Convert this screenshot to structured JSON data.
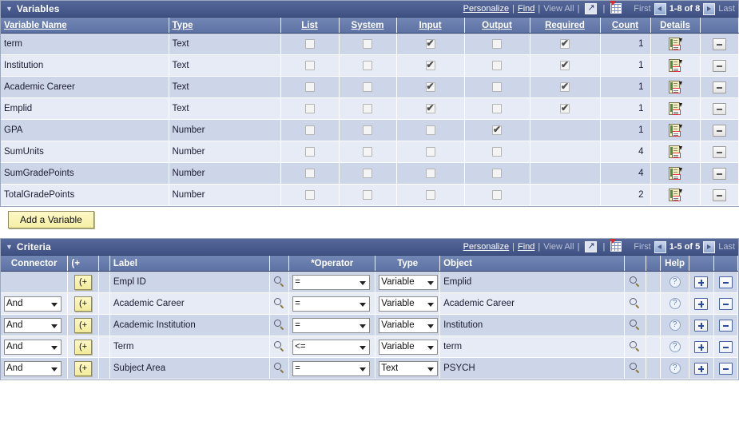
{
  "variables_section": {
    "title": "Variables",
    "toolbar": {
      "personalize": "Personalize",
      "find": "Find",
      "view_all": "View All",
      "expand_icon": "expand-icon",
      "grid_icon": "download-spreadsheet-icon",
      "first": "First",
      "range": "1-8 of 8",
      "last": "Last"
    },
    "columns": [
      "Variable Name",
      "Type",
      "List",
      "System",
      "Input",
      "Output",
      "Required",
      "Count",
      "Details",
      ""
    ],
    "rows": [
      {
        "name": "term",
        "type": "Text",
        "list": false,
        "system": false,
        "input": true,
        "output": false,
        "required": true,
        "count": "1",
        "has_required_box": true
      },
      {
        "name": "Institution",
        "type": "Text",
        "list": false,
        "system": false,
        "input": true,
        "output": false,
        "required": true,
        "count": "1",
        "has_required_box": true
      },
      {
        "name": "Academic Career",
        "type": "Text",
        "list": false,
        "system": false,
        "input": true,
        "output": false,
        "required": true,
        "count": "1",
        "has_required_box": true
      },
      {
        "name": "Emplid",
        "type": "Text",
        "list": false,
        "system": false,
        "input": true,
        "output": false,
        "required": true,
        "count": "1",
        "has_required_box": true
      },
      {
        "name": "GPA",
        "type": "Number",
        "list": false,
        "system": false,
        "input": false,
        "output": true,
        "required": false,
        "count": "1",
        "has_required_box": false
      },
      {
        "name": "SumUnits",
        "type": "Number",
        "list": false,
        "system": false,
        "input": false,
        "output": false,
        "required": false,
        "count": "4",
        "has_required_box": false
      },
      {
        "name": "SumGradePoints",
        "type": "Number",
        "list": false,
        "system": false,
        "input": false,
        "output": false,
        "required": false,
        "count": "4",
        "has_required_box": false
      },
      {
        "name": "TotalGradePoints",
        "type": "Number",
        "list": false,
        "system": false,
        "input": false,
        "output": false,
        "required": false,
        "count": "2",
        "has_required_box": false
      }
    ]
  },
  "add_variable_button": "Add a Variable",
  "criteria_section": {
    "title": "Criteria",
    "toolbar": {
      "personalize": "Personalize",
      "find": "Find",
      "view_all": "View All",
      "expand_icon": "expand-icon",
      "grid_icon": "download-spreadsheet-icon",
      "first": "First",
      "range": "1-5 of 5",
      "last": "Last"
    },
    "columns": [
      "Connector",
      "(+",
      "",
      "Label",
      "",
      "*Operator",
      "Type",
      "Object",
      "",
      "",
      "Help",
      "",
      ""
    ],
    "group_button_label": "(+",
    "rows": [
      {
        "connector": "",
        "label": "Empl ID",
        "operator": "=",
        "type": "Variable",
        "object": "Emplid",
        "help": "?"
      },
      {
        "connector": "And",
        "label": "Academic Career",
        "operator": "=",
        "type": "Variable",
        "object": "Academic Career",
        "help": "?"
      },
      {
        "connector": "And",
        "label": "Academic Institution",
        "operator": "=",
        "type": "Variable",
        "object": "Institution",
        "help": "?"
      },
      {
        "connector": "And",
        "label": "Term",
        "operator": "<=",
        "type": "Variable",
        "object": "term",
        "help": "?"
      },
      {
        "connector": "And",
        "label": "Subject Area",
        "operator": "=",
        "type": "Text",
        "object": "PSYCH",
        "help": "?"
      }
    ]
  }
}
